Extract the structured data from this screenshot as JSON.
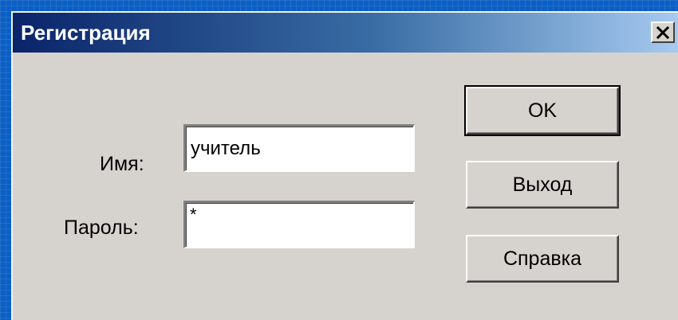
{
  "window": {
    "title": "Регистрация",
    "close_label": "×"
  },
  "form": {
    "username_label": "Имя:",
    "username_value": "учитель",
    "password_label": "Пароль:",
    "password_value": "*"
  },
  "buttons": {
    "ok": "OK",
    "exit": "Выход",
    "help": "Справка"
  },
  "icons": {
    "close": "close-icon"
  }
}
